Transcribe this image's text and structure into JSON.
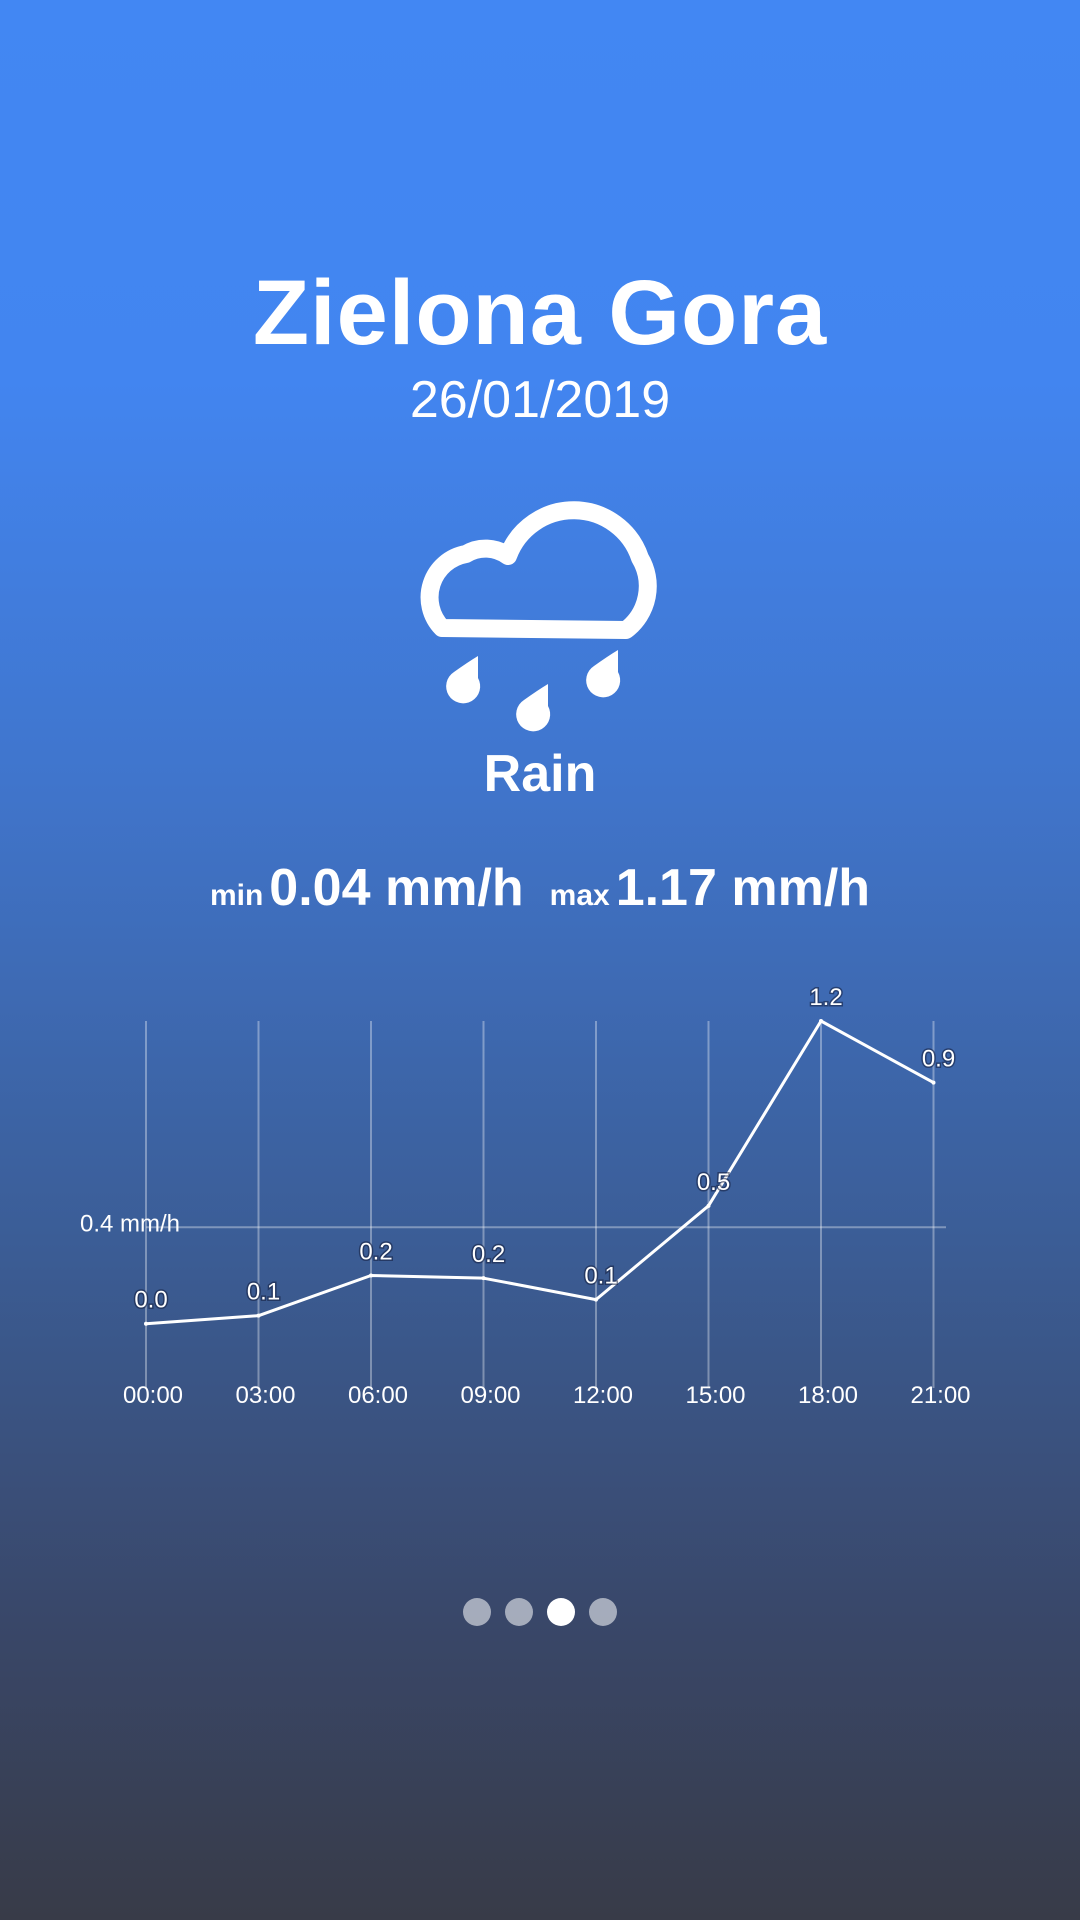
{
  "location": {
    "city": "Zielona Gora",
    "date": "26/01/2019"
  },
  "condition": {
    "icon": "rain-cloud-icon",
    "label": "Rain"
  },
  "precipitation": {
    "min_label": "min",
    "min_value": "0.04 mm/h",
    "max_label": "max",
    "max_value": "1.17 mm/h"
  },
  "chart_data": {
    "type": "line",
    "categories": [
      "00:00",
      "03:00",
      "06:00",
      "09:00",
      "12:00",
      "15:00",
      "18:00",
      "21:00"
    ],
    "values": [
      0.04,
      0.07,
      0.22,
      0.21,
      0.13,
      0.48,
      1.17,
      0.94
    ],
    "data_labels": [
      "0.0",
      "0.1",
      "0.2",
      "0.2",
      "0.1",
      "0.5",
      "1.2",
      "0.9"
    ],
    "ylim": [
      -0.2,
      1.17
    ],
    "reference_line": {
      "value": 0.4,
      "label": "0.4 mm/h"
    },
    "grid": "vertical",
    "line_color": "#ffffff"
  },
  "pager": {
    "count": 4,
    "active_index": 2
  }
}
